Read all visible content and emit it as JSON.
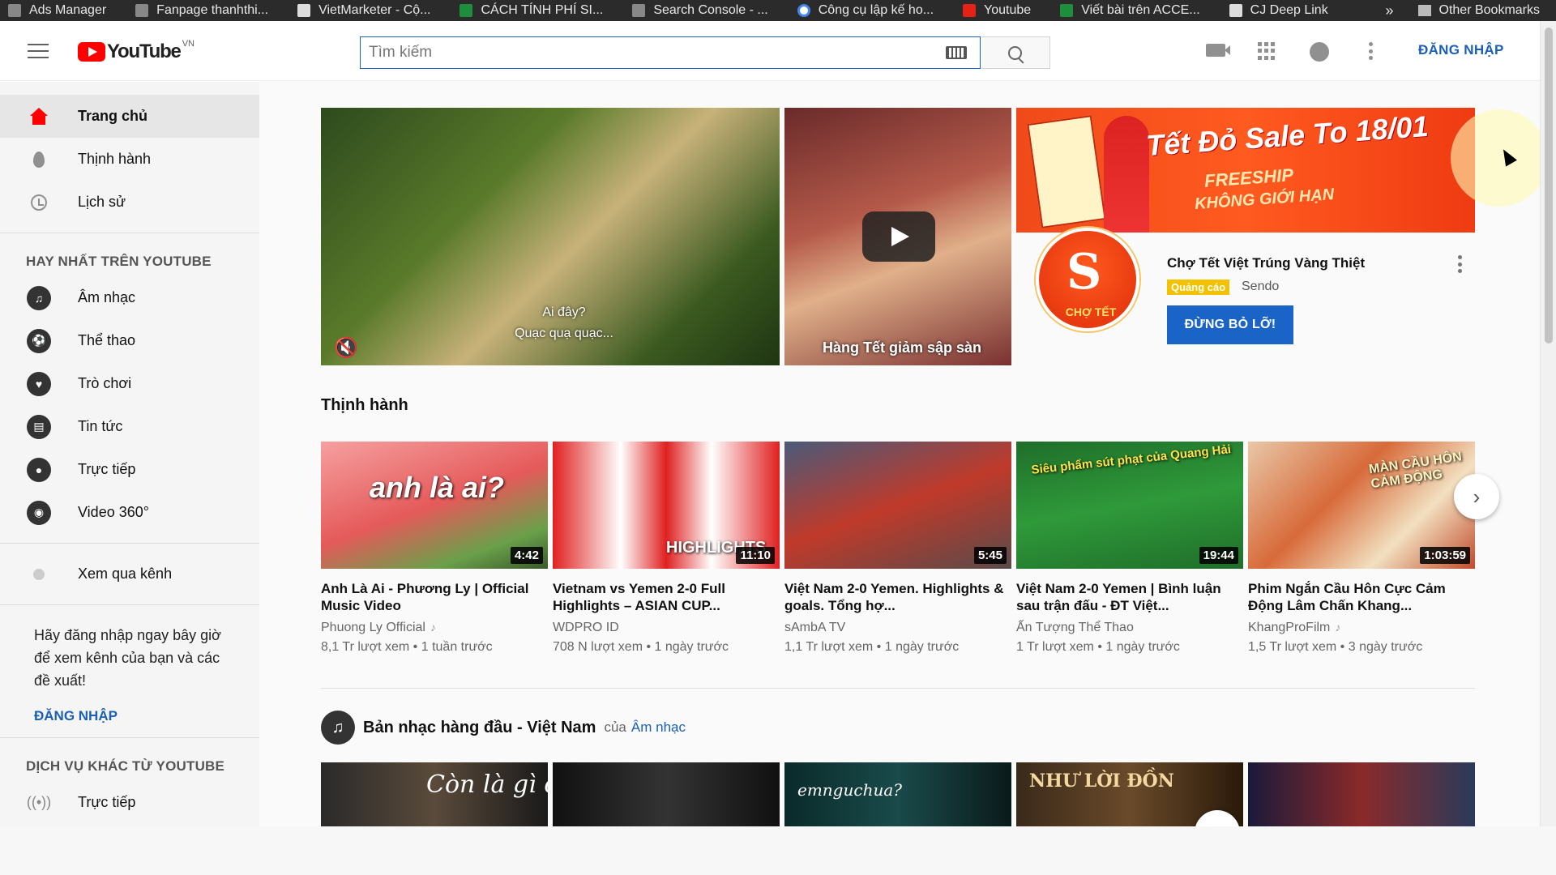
{
  "bookmarks": {
    "items": [
      {
        "label": "Ads Manager",
        "icon": "page-icon"
      },
      {
        "label": "Fanpage thanhthi...",
        "icon": "page-icon"
      },
      {
        "label": "VietMarketer - Cộ...",
        "icon": "doc-icon"
      },
      {
        "label": "CÁCH TÍNH PHÍ SI...",
        "icon": "sheets-icon"
      },
      {
        "label": "Search Console - ...",
        "icon": "page-icon"
      },
      {
        "label": "Công cụ lập kế ho...",
        "icon": "google-icon"
      },
      {
        "label": "Youtube",
        "icon": "youtube-icon"
      },
      {
        "label": "Viết bài trên ACCE...",
        "icon": "sheets-icon"
      },
      {
        "label": "CJ Deep Link",
        "icon": "doc-icon"
      }
    ],
    "overflow": "»",
    "other": "Other Bookmarks"
  },
  "masthead": {
    "logo_text": "YouTube",
    "country_code": "VN",
    "search_placeholder": "Tìm kiếm",
    "signin": "ĐĂNG NHẬP"
  },
  "sidebar": {
    "primary": [
      {
        "label": "Trang chủ",
        "icon": "home-icon",
        "active": true
      },
      {
        "label": "Thịnh hành",
        "icon": "flame-icon"
      },
      {
        "label": "Lịch sử",
        "icon": "history-icon"
      }
    ],
    "best_heading": "HAY NHẤT TRÊN YOUTUBE",
    "best": [
      {
        "label": "Âm nhạc",
        "icon": "music-icon",
        "glyph": "♫"
      },
      {
        "label": "Thể thao",
        "icon": "sports-icon",
        "glyph": "⚽"
      },
      {
        "label": "Trò chơi",
        "icon": "gaming-icon",
        "glyph": "♥"
      },
      {
        "label": "Tin tức",
        "icon": "news-icon",
        "glyph": "▤"
      },
      {
        "label": "Trực tiếp",
        "icon": "live-icon",
        "glyph": "●"
      },
      {
        "label": "Video 360°",
        "icon": "vr-icon",
        "glyph": "◉"
      }
    ],
    "browse_channels": "Xem qua kênh",
    "signin_prompt": "Hãy đăng nhập ngay bây giờ để xem kênh của bạn và các đề xuất!",
    "signin": "ĐĂNG NHẬP",
    "more_heading": "DỊCH VỤ KHÁC TỪ YOUTUBE",
    "more": [
      {
        "label": "Trực tiếp",
        "icon": "live-broadcast-icon"
      }
    ]
  },
  "hero": {
    "video1_caption": "Ai đây?\nQuạc quạ quạc...",
    "video2_caption": "Hàng Tết giảm sập sàn"
  },
  "ad": {
    "banner_headline": "Tết Đỏ Sale To 18/01",
    "banner_line1": "FREESHIP",
    "banner_line2": "KHÔNG GIỚI HẠN",
    "logo_text": "CHỢ TẾT",
    "title": "Chợ Tết Việt Trúng Vàng Thiệt",
    "badge": "Quảng cáo",
    "channel": "Sendo",
    "cta": "ĐỪNG BỎ LỠ!"
  },
  "trending": {
    "title": "Thịnh hành",
    "videos": [
      {
        "title": "Anh Là Ai - Phương Ly | Official Music Video",
        "channel": "Phuong Ly Official",
        "music": true,
        "views": "8,1 Tr lượt xem",
        "age": "1 tuần trước",
        "duration": "4:42",
        "thumb_text": "anh là ai?"
      },
      {
        "title": "Vietnam vs Yemen 2-0 Full Highlights – ASIAN CUP...",
        "channel": "WDPRO ID",
        "music": false,
        "views": "708 N lượt xem",
        "age": "1 ngày trước",
        "duration": "11:10",
        "thumb_text": "HIGHLIGHTS"
      },
      {
        "title": "Việt Nam 2-0 Yemen. Highlights & goals. Tổng hợ...",
        "channel": "sAmbA TV",
        "music": false,
        "views": "1,1 Tr lượt xem",
        "age": "1 ngày trước",
        "duration": "5:45",
        "thumb_text": ""
      },
      {
        "title": "Việt Nam 2-0 Yemen | Bình luận sau trận đấu - ĐT Việt...",
        "channel": "Ấn Tượng Thể Thao",
        "music": false,
        "views": "1 Tr lượt xem",
        "age": "1 ngày trước",
        "duration": "19:44",
        "thumb_text": "Siêu phẩm sút phạt của Quang Hải"
      },
      {
        "title": "Phim Ngắn Cầu Hôn Cực Cảm Động Lâm Chấn Khang...",
        "channel": "KhangProFilm",
        "music": true,
        "views": "1,5 Tr lượt xem",
        "age": "3 ngày trước",
        "duration": "1:03:59",
        "thumb_text": "MÀN CẦU HÔN CẢM ĐỘNG"
      }
    ]
  },
  "music_shelf": {
    "title": "Bản nhạc hàng đầu - Việt Nam",
    "by": "của",
    "link": "Âm nhạc",
    "thumbs": [
      "Còn là gì của nhau",
      "",
      "emnguchua?",
      "NHƯ LỜI ĐỒN",
      ""
    ]
  },
  "colors": {
    "brand_red": "#ff0000",
    "link_blue": "#1a5fb4",
    "cta_blue": "#1a64c8",
    "ad_badge": "#f2c200"
  }
}
